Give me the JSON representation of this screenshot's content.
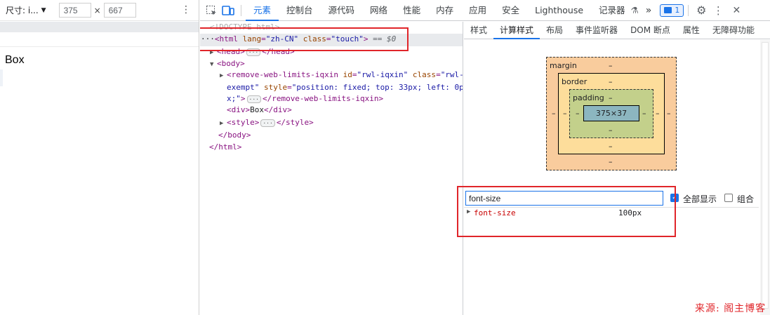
{
  "device_toolbar": {
    "dimension_label": "尺寸: i...",
    "width_value": "375",
    "times": "×",
    "height_value": "667",
    "more_icon": "⋮"
  },
  "device_content": {
    "text": "Box"
  },
  "tabs": {
    "items": [
      "元素",
      "控制台",
      "源代码",
      "网络",
      "性能",
      "内存",
      "应用",
      "安全",
      "Lighthouse",
      "记录器"
    ],
    "overflow": "»",
    "issues_count": "1",
    "settings_icon": "⚙",
    "more_icon": "⋮",
    "close_icon": "✕",
    "recorder_icon": "⚗"
  },
  "dom": {
    "doctype": "<!DOCTYPE html>",
    "html_ellipsis": "···",
    "html_open_tag": "<html",
    "html_attr1": " lang",
    "html_val1": "\"zh-CN\"",
    "html_attr2": " class",
    "html_val2": "\"touch\"",
    "html_close_bracket": ">",
    "selected_marker": " == $0",
    "head_open": "<head>",
    "head_close": "</head>",
    "body_open": "<body>",
    "rwl_open": "<remove-web-limits-iqxin",
    "rwl_attr1": " id",
    "rwl_val1": "\"rwl-iqxin\"",
    "rwl_attr2": " class",
    "rwl_val2_a": "\"rwl-",
    "rwl_val2_b": "exempt\"",
    "rwl_attr3": " style",
    "rwl_val3_a": "\"position: fixed; top: 33px; left: 0p",
    "rwl_val3_b": "x;\"",
    "rwl_close_bracket": ">",
    "rwl_end": "</remove-web-limits-iqxin>",
    "div_open": "<div>",
    "div_text": "Box",
    "div_close": "</div>",
    "style_open": "<style>",
    "style_close": "</style>",
    "body_close": "</body>",
    "html_close": "</html>",
    "equals": "=",
    "ellipsis_chip": "···"
  },
  "side_tabs": [
    "样式",
    "计算样式",
    "布局",
    "事件监听器",
    "DOM 断点",
    "属性",
    "无障碍功能"
  ],
  "box_model": {
    "margin_label": "margin",
    "border_label": "border",
    "padding_label": "padding",
    "content_size": "375×37",
    "dash": "–"
  },
  "computed": {
    "filter_value": "font-size",
    "show_all_label": "全部显示",
    "show_all_checked": true,
    "group_label": "组合",
    "group_checked": false,
    "property_name": "font-size",
    "property_value": "100px"
  },
  "watermark": "来源: 阁主博客",
  "colors": {
    "accent": "#1a73e8",
    "annotation_red": "#e0252a"
  }
}
